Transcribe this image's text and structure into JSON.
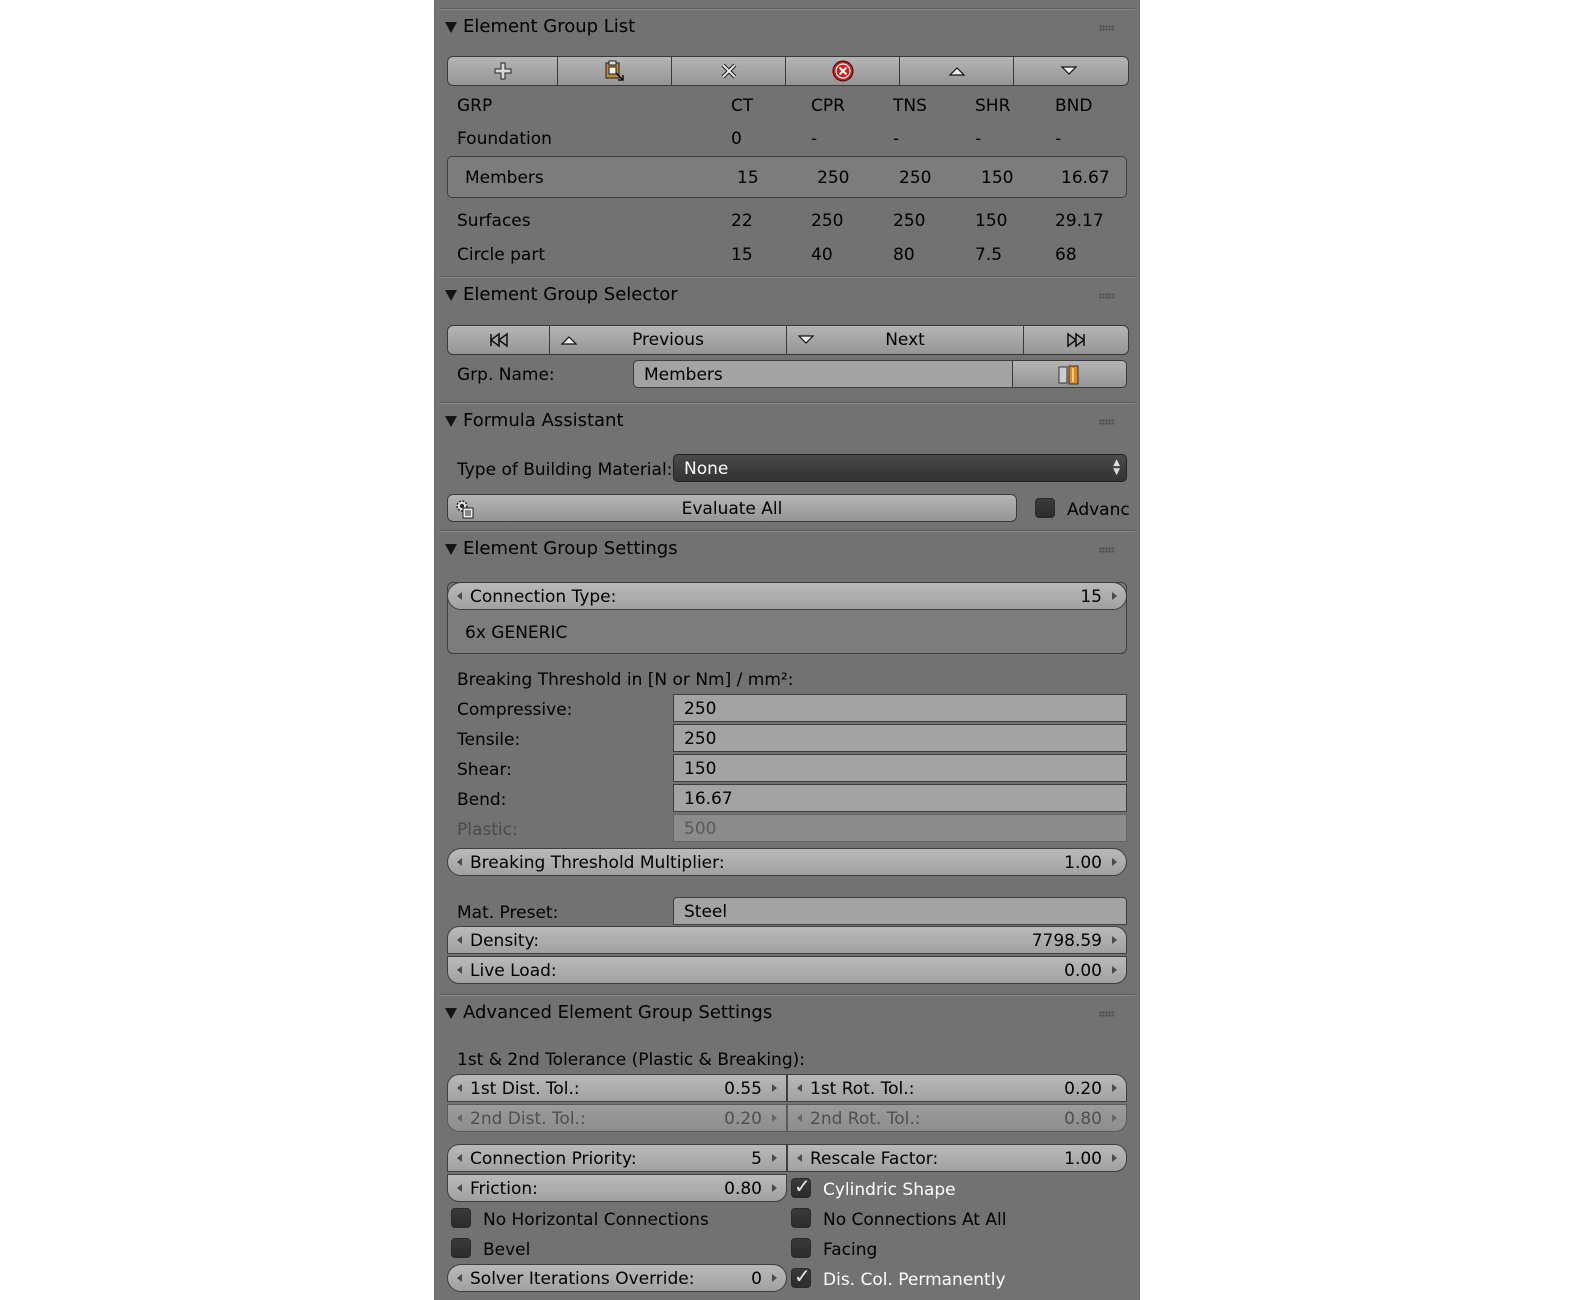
{
  "group_list": {
    "title": "Element Group List",
    "toolbar_icons": [
      "plus-icon",
      "paste-icon",
      "remove-icon",
      "delete-all-icon",
      "move-up-icon",
      "move-down-icon"
    ],
    "columns": [
      "GRP",
      "CT",
      "CPR",
      "TNS",
      "SHR",
      "BND"
    ],
    "rows": [
      {
        "grp": "Foundation",
        "ct": "0",
        "cpr": "-",
        "tns": "-",
        "shr": "-",
        "bnd": "-"
      },
      {
        "grp": "Members",
        "ct": "15",
        "cpr": "250",
        "tns": "250",
        "shr": "150",
        "bnd": "16.67"
      },
      {
        "grp": "Surfaces",
        "ct": "22",
        "cpr": "250",
        "tns": "250",
        "shr": "150",
        "bnd": "29.17"
      },
      {
        "grp": "Circle part",
        "ct": "15",
        "cpr": "40",
        "tns": "80",
        "shr": "7.5",
        "bnd": "68"
      }
    ]
  },
  "selector": {
    "title": "Element Group Selector",
    "previous_label": "Previous",
    "next_label": "Next",
    "grp_name_label": "Grp. Name:",
    "grp_name_value": "Members"
  },
  "formula": {
    "title": "Formula Assistant",
    "material_label": "Type of Building Material:",
    "material_value": "None",
    "evaluate_label": "Evaluate All",
    "advanced_label": "Advanc"
  },
  "settings": {
    "title": "Element Group Settings",
    "connection_type_label": "Connection Type:",
    "connection_type_value": "15",
    "connection_desc": "6x GENERIC",
    "threshold_heading": "Breaking Threshold in [N or Nm] / mm²:",
    "compressive_label": "Compressive:",
    "compressive_value": "250",
    "tensile_label": "Tensile:",
    "tensile_value": "250",
    "shear_label": "Shear:",
    "shear_value": "150",
    "bend_label": "Bend:",
    "bend_value": "16.67",
    "plastic_label": "Plastic:",
    "plastic_value": "500",
    "multiplier_label": "Breaking Threshold Multiplier:",
    "multiplier_value": "1.00",
    "mat_preset_label": "Mat. Preset:",
    "mat_preset_value": "Steel",
    "density_label": "Density:",
    "density_value": "7798.59",
    "live_load_label": "Live Load:",
    "live_load_value": "0.00"
  },
  "advanced": {
    "title": "Advanced Element Group Settings",
    "tolerance_heading": "1st & 2nd Tolerance (Plastic & Breaking):",
    "dist_tol1_label": "1st Dist. Tol.:",
    "dist_tol1_value": "0.55",
    "rot_tol1_label": "1st Rot. Tol.:",
    "rot_tol1_value": "0.20",
    "dist_tol2_label": "2nd Dist. Tol.:",
    "dist_tol2_value": "0.20",
    "rot_tol2_label": "2nd Rot. Tol.:",
    "rot_tol2_value": "0.80",
    "priority_label": "Connection Priority:",
    "priority_value": "5",
    "rescale_label": "Rescale Factor:",
    "rescale_value": "1.00",
    "friction_label": "Friction:",
    "friction_value": "0.80",
    "cylindric_label": "Cylindric Shape",
    "no_horizontal_label": "No Horizontal Connections",
    "no_connections_label": "No Connections At All",
    "bevel_label": "Bevel",
    "facing_label": "Facing",
    "solver_label": "Solver Iterations Override:",
    "solver_value": "0",
    "dis_col_label": "Dis. Col. Permanently"
  }
}
